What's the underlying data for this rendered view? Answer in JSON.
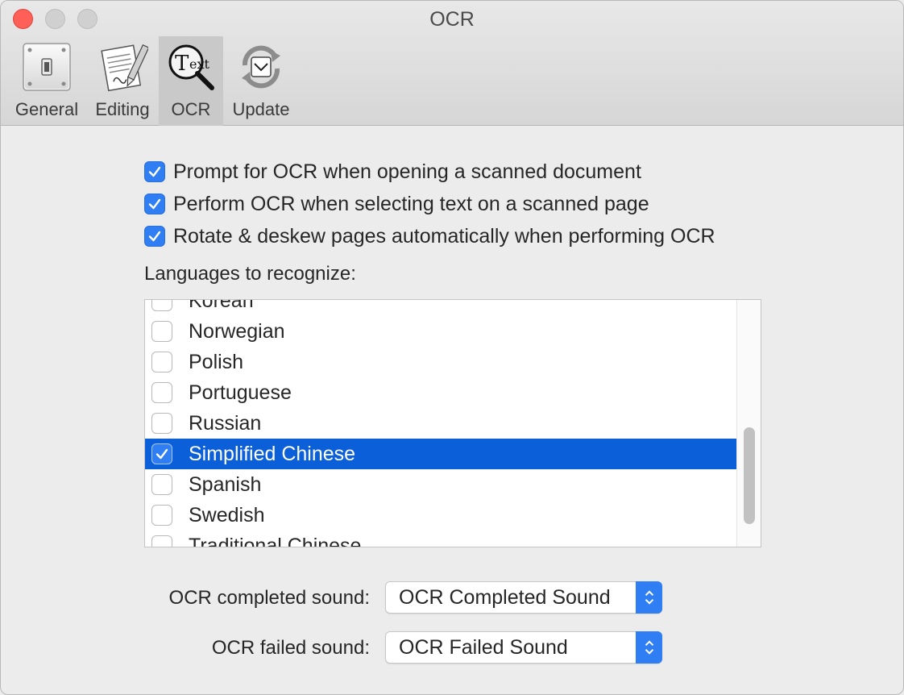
{
  "window": {
    "title": "OCR"
  },
  "toolbar": {
    "tabs": [
      {
        "label": "General",
        "icon": "switch-icon"
      },
      {
        "label": "Editing",
        "icon": "document-pen-icon"
      },
      {
        "label": "OCR",
        "icon": "magnifier-text-icon",
        "active": true
      },
      {
        "label": "Update",
        "icon": "refresh-icon"
      }
    ]
  },
  "options": [
    {
      "label": "Prompt for OCR when opening a scanned document",
      "checked": true
    },
    {
      "label": "Perform OCR when selecting text on a scanned page",
      "checked": true
    },
    {
      "label": "Rotate & deskew pages automatically when performing OCR",
      "checked": true
    }
  ],
  "languages": {
    "label": "Languages to recognize:",
    "items": [
      {
        "name": "Korean",
        "checked": false
      },
      {
        "name": "Norwegian",
        "checked": false
      },
      {
        "name": "Polish",
        "checked": false
      },
      {
        "name": "Portuguese",
        "checked": false
      },
      {
        "name": "Russian",
        "checked": false
      },
      {
        "name": "Simplified Chinese",
        "checked": true,
        "selected": true
      },
      {
        "name": "Spanish",
        "checked": false
      },
      {
        "name": "Swedish",
        "checked": false
      },
      {
        "name": "Traditional Chinese",
        "checked": false
      }
    ]
  },
  "sounds": {
    "completed_label": "OCR completed sound:",
    "completed_value": "OCR Completed Sound",
    "failed_label": "OCR failed sound:",
    "failed_value": "OCR Failed Sound"
  },
  "colors": {
    "accent": "#2f7ef3",
    "selection": "#0b5fd8",
    "close": "#fe5f57"
  }
}
